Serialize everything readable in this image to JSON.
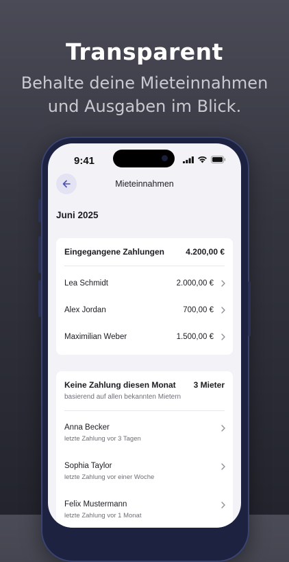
{
  "hero": {
    "title": "Transparent",
    "subtitle": "Behalte deine Mieteinnahmen\nund Ausgaben im Blick."
  },
  "status_bar": {
    "time": "9:41",
    "icons": [
      "signal-icon",
      "wifi-icon",
      "battery-icon"
    ]
  },
  "nav": {
    "back_icon": "arrow-left-icon",
    "title": "Mieteinnahmen"
  },
  "month": "Juni 2025",
  "received": {
    "title": "Eingegangene Zahlungen",
    "total": "4.200,00 €",
    "rows": [
      {
        "name": "Lea Schmidt",
        "amount": "2.000,00 €"
      },
      {
        "name": "Alex Jordan",
        "amount": "700,00 €"
      },
      {
        "name": "Maximilian Weber",
        "amount": "1.500,00 €"
      }
    ]
  },
  "missing": {
    "title": "Keine Zahlung diesen Monat",
    "count": "3 Mieter",
    "subtitle": "basierend auf allen bekannten Mietern",
    "rows": [
      {
        "name": "Anna Becker",
        "detail": "letzte Zahlung vor 3 Tagen"
      },
      {
        "name": "Sophia Taylor",
        "detail": "letzte Zahlung vor einer Woche"
      },
      {
        "name": "Felix Mustermann",
        "detail": "letzte Zahlung vor 1 Monat"
      }
    ]
  },
  "colors": {
    "background": "#34353f",
    "screen": "#f3f2f7",
    "accent": "#4a4fb0",
    "phone_frame": "#1c2240"
  }
}
